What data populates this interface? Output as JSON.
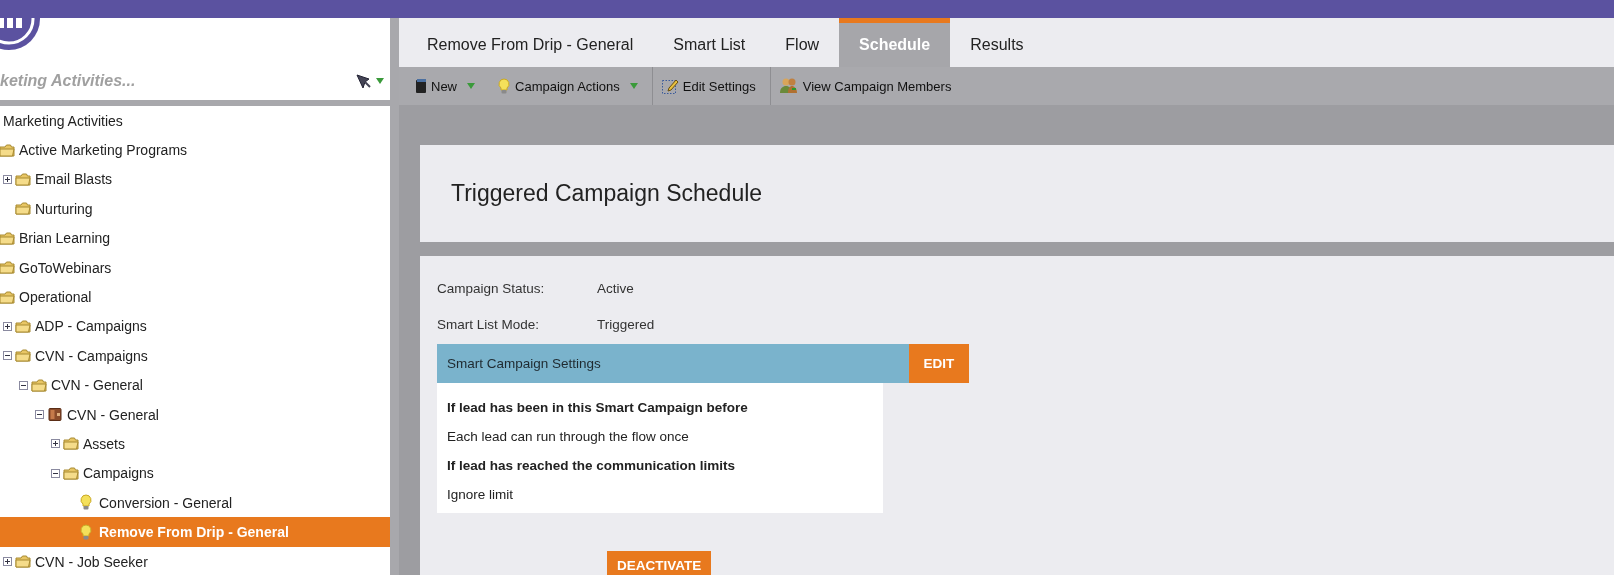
{
  "sidebar": {
    "search": {
      "placeholder": "keting Activities..."
    },
    "tree": [
      {
        "label": "Marketing Activities",
        "selected": false,
        "children": [
          {
            "label": "Active Marketing Programs",
            "kind": "folder",
            "selected": false,
            "children": [
              {
                "label": "Email Blasts",
                "kind": "folder",
                "selected": false,
                "expanded": false
              },
              {
                "label": "Nurturing",
                "kind": "folder",
                "selected": false
              }
            ]
          },
          {
            "label": "Brian Learning",
            "kind": "folder",
            "selected": false
          },
          {
            "label": "GoToWebinars",
            "kind": "folder",
            "selected": false
          },
          {
            "label": "Operational",
            "kind": "folder",
            "selected": false,
            "children": [
              {
                "label": "ADP - Campaigns",
                "kind": "folder",
                "selected": false,
                "expanded": false
              },
              {
                "label": "CVN - Campaigns",
                "kind": "folder",
                "selected": false,
                "expanded": true,
                "children": [
                  {
                    "label": "CVN - General",
                    "kind": "folder",
                    "selected": false,
                    "expanded": true,
                    "children": [
                      {
                        "label": "CVN - General",
                        "kind": "program",
                        "selected": false,
                        "expanded": true,
                        "children": [
                          {
                            "label": "Assets",
                            "kind": "folder",
                            "selected": false,
                            "expanded": false
                          },
                          {
                            "label": "Campaigns",
                            "kind": "folder",
                            "selected": false,
                            "expanded": true,
                            "children": [
                              {
                                "label": "Conversion - General",
                                "kind": "campaign",
                                "selected": false
                              },
                              {
                                "label": "Remove From Drip - General",
                                "kind": "campaign",
                                "selected": true
                              }
                            ]
                          }
                        ]
                      }
                    ]
                  }
                ]
              },
              {
                "label": "CVN - Job Seeker",
                "kind": "folder",
                "selected": false,
                "expanded": false
              }
            ]
          }
        ]
      }
    ]
  },
  "tabs": [
    {
      "label": "Remove From Drip - General",
      "selected": false
    },
    {
      "label": "Smart List",
      "selected": false
    },
    {
      "label": "Flow",
      "selected": false
    },
    {
      "label": "Schedule",
      "selected": true
    },
    {
      "label": "Results",
      "selected": false
    }
  ],
  "toolbar": [
    {
      "label": "New",
      "kind": "new",
      "dropdown": true
    },
    {
      "label": "Campaign Actions",
      "kind": "actions",
      "dropdown": true
    },
    {
      "label": "Edit Settings",
      "kind": "edit",
      "dropdown": false
    },
    {
      "label": "View Campaign Members",
      "kind": "members",
      "dropdown": false
    }
  ],
  "schedule": {
    "title": "Triggered Campaign Schedule",
    "fields": [
      {
        "label": "Campaign Status:",
        "value": "Active"
      },
      {
        "label": "Smart List Mode:",
        "value": "Triggered"
      }
    ],
    "settings": {
      "title": "Smart Campaign Settings",
      "edit_label": "EDIT",
      "lines": [
        {
          "text": "If lead has been in this Smart Campaign before",
          "kind": "heading"
        },
        {
          "text": "Each lead can run through the flow once",
          "kind": "value"
        },
        {
          "text": "If lead has reached the communication limits",
          "kind": "heading"
        },
        {
          "text": "Ignore limit",
          "kind": "value"
        }
      ]
    },
    "deactivate_label": "DEACTIVATE"
  }
}
